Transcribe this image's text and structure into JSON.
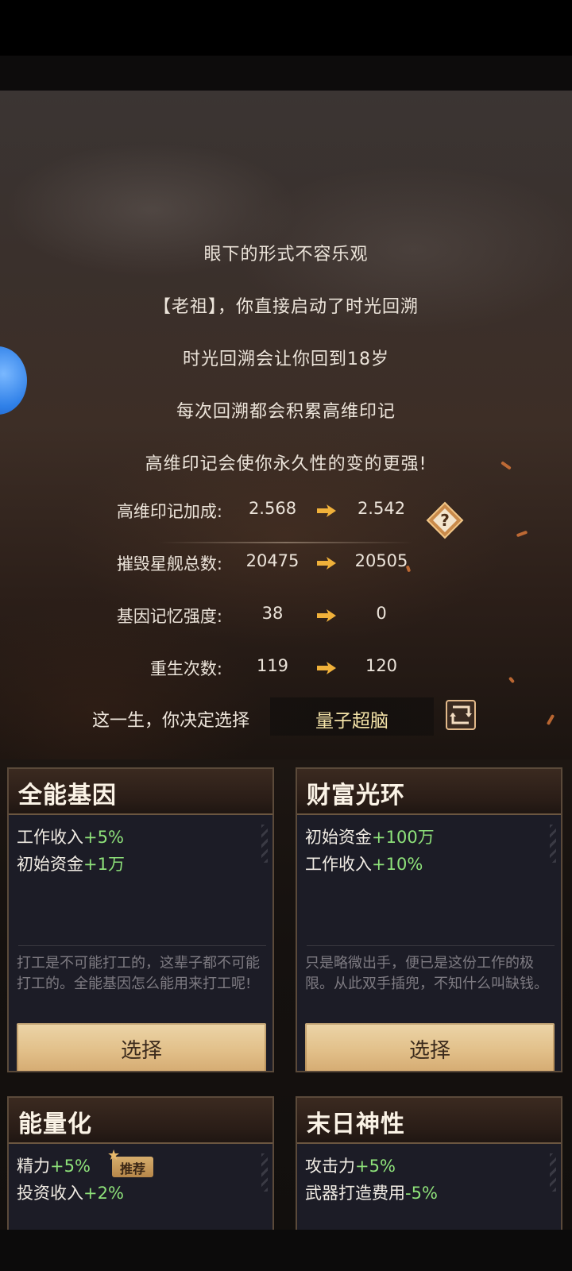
{
  "story": {
    "lines": [
      "眼下的形式不容乐观",
      "【老祖】，你直接启动了时光回溯",
      "时光回溯会让你回到18岁",
      "每次回溯都会积累高维印记",
      "高维印记会使你永久性的变的更强!"
    ],
    "stats": [
      {
        "label": "高维印记加成:",
        "old": "2.568",
        "new": "2.542"
      },
      {
        "label": "摧毁星舰总数:",
        "old": "20475",
        "new": "20505"
      },
      {
        "label": "基因记忆强度:",
        "old": "38",
        "new": "0"
      },
      {
        "label": "重生次数:",
        "old": "119",
        "new": "120"
      }
    ],
    "help_icon": "question-diamond-icon",
    "choice_label": "这一生，你决定选择",
    "choice_value": "量子超脑",
    "reroll_icon": "reroll-icon"
  },
  "cards": [
    {
      "title": "全能基因",
      "effects": [
        {
          "name": "工作收入",
          "value": "+5%"
        },
        {
          "name": "初始资金",
          "value": "+1万"
        }
      ],
      "flavor": "打工是不可能打工的，这辈子都不可能打工的。全能基因怎么能用来打工呢!",
      "button": "选择"
    },
    {
      "title": "财富光环",
      "effects": [
        {
          "name": "初始资金",
          "value": "+100万"
        },
        {
          "name": "工作收入",
          "value": "+10%"
        }
      ],
      "flavor": "只是略微出手，便已是这份工作的极限。从此双手插兜，不知什么叫缺钱。",
      "button": "选择"
    },
    {
      "title": "能量化",
      "effects": [
        {
          "name": "精力",
          "value": "+5%"
        },
        {
          "name": "投资收入",
          "value": "+2%"
        }
      ],
      "badge": "推荐"
    },
    {
      "title": "末日神性",
      "effects": [
        {
          "name": "攻击力",
          "value": "+5%"
        },
        {
          "name": "武器打造费用",
          "value": "-5%"
        }
      ]
    }
  ],
  "colors": {
    "positive": "#8ee27a",
    "choice_text": "#f4e3a8",
    "arrow": "#f0b13a",
    "button_gold": "#e2c08a"
  }
}
